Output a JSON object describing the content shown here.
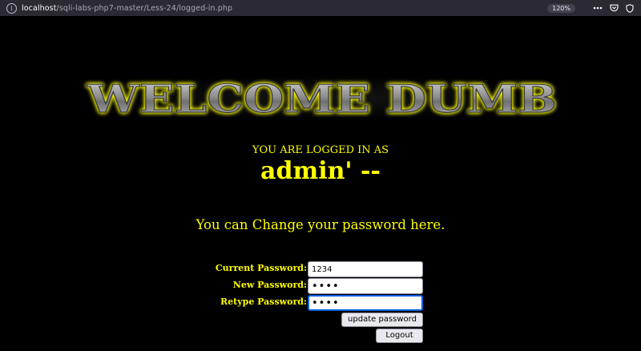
{
  "browser": {
    "url_host": "localhost",
    "url_path": "/sqli-labs-php7-master/Less-24/logged-in.php",
    "zoom": "120%",
    "icons": [
      "info-icon",
      "more-icon",
      "pocket-icon",
      "shield-icon"
    ]
  },
  "banner": {
    "text": "WELCOME DUMB"
  },
  "session": {
    "logged_in_label": "YOU ARE LOGGED IN AS",
    "username": "admin' --"
  },
  "change_password": {
    "message": "You can Change your password here.",
    "current_label": "Current Password:",
    "current_value": "1234",
    "new_label": "New Password:",
    "new_value": "1234",
    "retype_label": "Retype Password:",
    "retype_value": "1234",
    "update_button": "update password",
    "logout_button": "Logout"
  },
  "colors": {
    "background": "#000000",
    "text": "#ffff00",
    "banner_glow": "#ffff00",
    "banner_fill": "#9a9a9a",
    "urlbar": "#2b2a33",
    "focus": "#0061e0"
  }
}
